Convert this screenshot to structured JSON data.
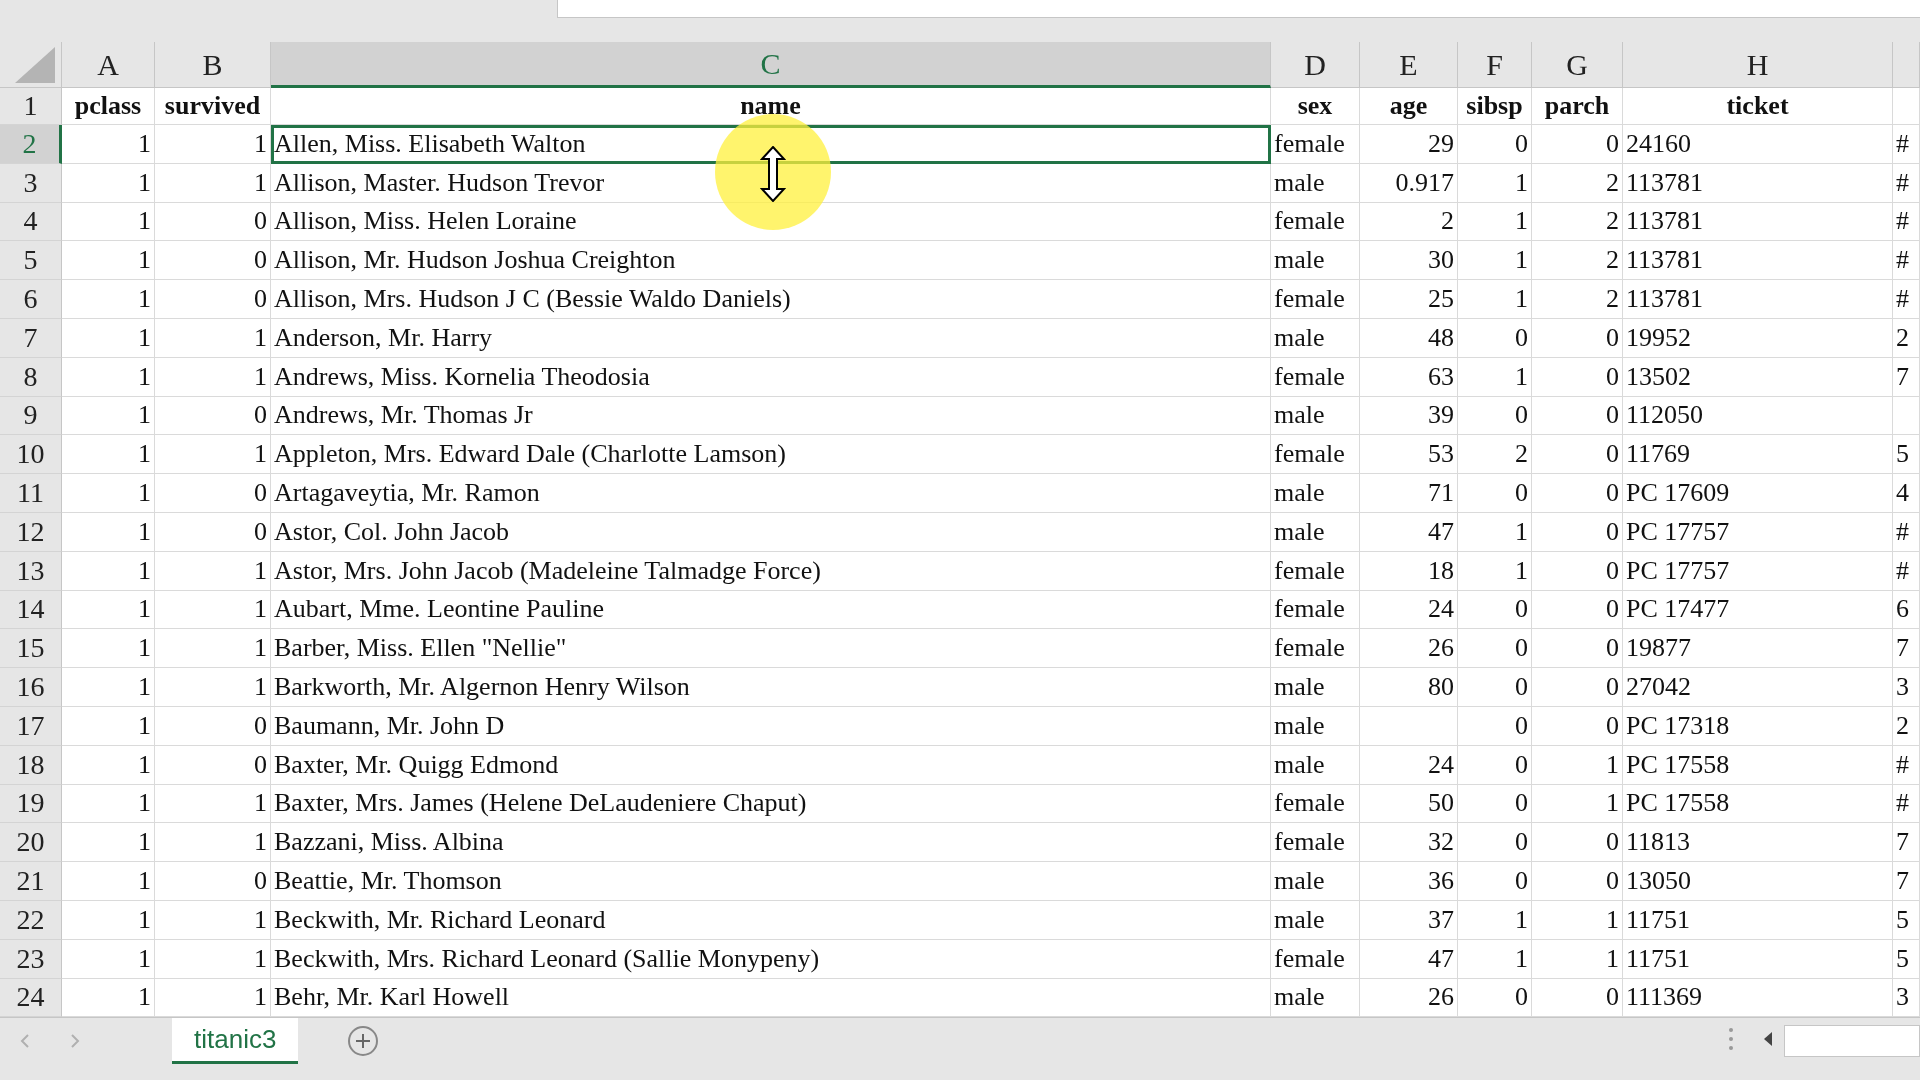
{
  "columns": [
    {
      "letter": "A",
      "selected": false,
      "kind": "number"
    },
    {
      "letter": "B",
      "selected": false,
      "kind": "number"
    },
    {
      "letter": "C",
      "selected": true,
      "kind": "text"
    },
    {
      "letter": "D",
      "selected": false,
      "kind": "text"
    },
    {
      "letter": "E",
      "selected": false,
      "kind": "number"
    },
    {
      "letter": "F",
      "selected": false,
      "kind": "number"
    },
    {
      "letter": "G",
      "selected": false,
      "kind": "number"
    },
    {
      "letter": "H",
      "selected": false,
      "kind": "text"
    },
    {
      "selected": false,
      "kind": "text"
    }
  ],
  "rows": [
    {
      "number": "1",
      "kind": "header",
      "selected": false,
      "cells": [
        "pclass",
        "survived",
        "name",
        "sex",
        "age",
        "sibsp",
        "parch",
        "ticket",
        ""
      ]
    },
    {
      "number": "2",
      "kind": "data",
      "selected": true,
      "cells": [
        "1",
        "1",
        "Allen, Miss. Elisabeth Walton",
        "female",
        "29",
        "0",
        "0",
        "24160",
        "#"
      ]
    },
    {
      "number": "3",
      "kind": "data",
      "selected": false,
      "cells": [
        "1",
        "1",
        "Allison, Master. Hudson Trevor",
        "male",
        "0.917",
        "1",
        "2",
        "113781",
        "#"
      ]
    },
    {
      "number": "4",
      "kind": "data",
      "selected": false,
      "cells": [
        "1",
        "0",
        "Allison, Miss. Helen Loraine",
        "female",
        "2",
        "1",
        "2",
        "113781",
        "#"
      ]
    },
    {
      "number": "5",
      "kind": "data",
      "selected": false,
      "cells": [
        "1",
        "0",
        "Allison, Mr. Hudson Joshua Creighton",
        "male",
        "30",
        "1",
        "2",
        "113781",
        "#"
      ]
    },
    {
      "number": "6",
      "kind": "data",
      "selected": false,
      "cells": [
        "1",
        "0",
        "Allison, Mrs. Hudson J C (Bessie Waldo Daniels)",
        "female",
        "25",
        "1",
        "2",
        "113781",
        "#"
      ]
    },
    {
      "number": "7",
      "kind": "data",
      "selected": false,
      "cells": [
        "1",
        "1",
        "Anderson, Mr. Harry",
        "male",
        "48",
        "0",
        "0",
        "19952",
        "2"
      ]
    },
    {
      "number": "8",
      "kind": "data",
      "selected": false,
      "cells": [
        "1",
        "1",
        "Andrews, Miss. Kornelia Theodosia",
        "female",
        "63",
        "1",
        "0",
        "13502",
        "7"
      ]
    },
    {
      "number": "9",
      "kind": "data",
      "selected": false,
      "cells": [
        "1",
        "0",
        "Andrews, Mr. Thomas Jr",
        "male",
        "39",
        "0",
        "0",
        "112050",
        ""
      ]
    },
    {
      "number": "10",
      "kind": "data",
      "selected": false,
      "cells": [
        "1",
        "1",
        "Appleton, Mrs. Edward Dale (Charlotte Lamson)",
        "female",
        "53",
        "2",
        "0",
        "11769",
        "5"
      ]
    },
    {
      "number": "11",
      "kind": "data",
      "selected": false,
      "cells": [
        "1",
        "0",
        "Artagaveytia, Mr. Ramon",
        "male",
        "71",
        "0",
        "0",
        "PC 17609",
        "4"
      ]
    },
    {
      "number": "12",
      "kind": "data",
      "selected": false,
      "cells": [
        "1",
        "0",
        "Astor, Col. John Jacob",
        "male",
        "47",
        "1",
        "0",
        "PC 17757",
        "#"
      ]
    },
    {
      "number": "13",
      "kind": "data",
      "selected": false,
      "cells": [
        "1",
        "1",
        "Astor, Mrs. John Jacob (Madeleine Talmadge Force)",
        "female",
        "18",
        "1",
        "0",
        "PC 17757",
        "#"
      ]
    },
    {
      "number": "14",
      "kind": "data",
      "selected": false,
      "cells": [
        "1",
        "1",
        "Aubart, Mme. Leontine Pauline",
        "female",
        "24",
        "0",
        "0",
        "PC 17477",
        "6"
      ]
    },
    {
      "number": "15",
      "kind": "data",
      "selected": false,
      "cells": [
        "1",
        "1",
        "Barber, Miss. Ellen \"Nellie\"",
        "female",
        "26",
        "0",
        "0",
        "19877",
        "7"
      ]
    },
    {
      "number": "16",
      "kind": "data",
      "selected": false,
      "cells": [
        "1",
        "1",
        "Barkworth, Mr. Algernon Henry Wilson",
        "male",
        "80",
        "0",
        "0",
        "27042",
        "3"
      ]
    },
    {
      "number": "17",
      "kind": "data",
      "selected": false,
      "cells": [
        "1",
        "0",
        "Baumann, Mr. John D",
        "male",
        "",
        "0",
        "0",
        "PC 17318",
        "2"
      ]
    },
    {
      "number": "18",
      "kind": "data",
      "selected": false,
      "cells": [
        "1",
        "0",
        "Baxter, Mr. Quigg Edmond",
        "male",
        "24",
        "0",
        "1",
        "PC 17558",
        "#"
      ]
    },
    {
      "number": "19",
      "kind": "data",
      "selected": false,
      "cells": [
        "1",
        "1",
        "Baxter, Mrs. James (Helene DeLaudeniere Chaput)",
        "female",
        "50",
        "0",
        "1",
        "PC 17558",
        "#"
      ]
    },
    {
      "number": "20",
      "kind": "data",
      "selected": false,
      "cells": [
        "1",
        "1",
        "Bazzani, Miss. Albina",
        "female",
        "32",
        "0",
        "0",
        "11813",
        "7"
      ]
    },
    {
      "number": "21",
      "kind": "data",
      "selected": false,
      "cells": [
        "1",
        "0",
        "Beattie, Mr. Thomson",
        "male",
        "36",
        "0",
        "0",
        "13050",
        "7"
      ]
    },
    {
      "number": "22",
      "kind": "data",
      "selected": false,
      "cells": [
        "1",
        "1",
        "Beckwith, Mr. Richard Leonard",
        "male",
        "37",
        "1",
        "1",
        "11751",
        "5"
      ]
    },
    {
      "number": "23",
      "kind": "data",
      "selected": false,
      "cells": [
        "1",
        "1",
        "Beckwith, Mrs. Richard Leonard (Sallie Monypeny)",
        "female",
        "47",
        "1",
        "1",
        "11751",
        "5"
      ]
    },
    {
      "number": "24",
      "kind": "data",
      "selected": false,
      "cells": [
        "1",
        "1",
        "Behr, Mr. Karl Howell",
        "male",
        "26",
        "0",
        "0",
        "111369",
        "3"
      ]
    }
  ],
  "sheet_tabs": [
    {
      "label": "titanic3",
      "selected": true
    }
  ]
}
